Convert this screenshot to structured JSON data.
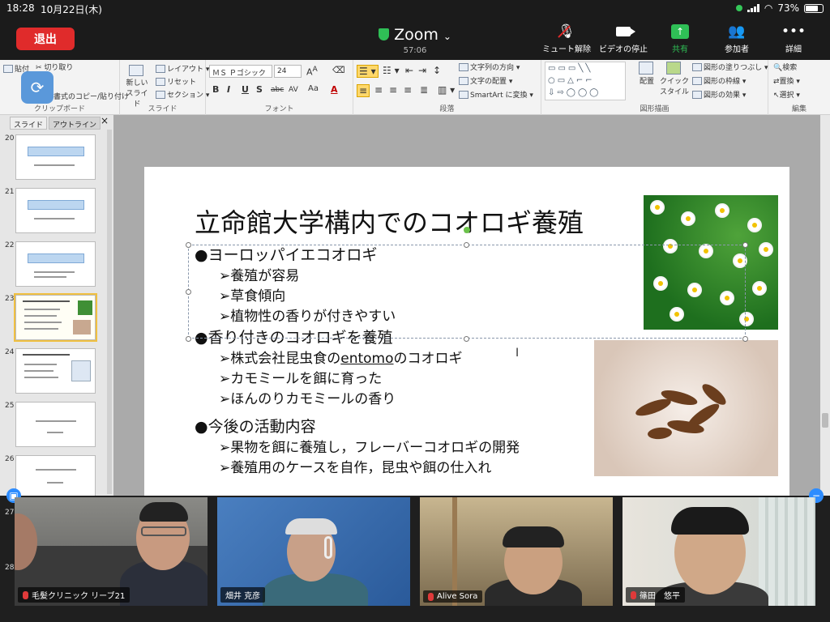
{
  "status_bar": {
    "time": "18:28",
    "date": "10月22日(木)",
    "battery": "73%",
    "battery_level": 0.73
  },
  "zoom": {
    "leave_label": "退出",
    "title": "Zoom",
    "elapsed": "57:06",
    "actions": [
      {
        "id": "mute",
        "label": "ミュート解除",
        "icon": "mic-off-icon"
      },
      {
        "id": "video",
        "label": "ビデオの停止",
        "icon": "video-camera-icon"
      },
      {
        "id": "share",
        "label": "共有",
        "icon": "share-arrow-icon"
      },
      {
        "id": "participants",
        "label": "参加者",
        "icon": "participants-icon"
      },
      {
        "id": "more",
        "label": "詳細",
        "icon": "more-dots-icon"
      }
    ]
  },
  "ribbon": {
    "clipboard": {
      "label": "クリップボード",
      "paste": "貼付",
      "cut": "切り取り",
      "copy_format": "書式のコピー/貼り付け"
    },
    "slides": {
      "label": "スライド",
      "new_slide": "新しい スライド",
      "layout": "レイアウト",
      "reset": "リセット",
      "section": "セクション"
    },
    "font": {
      "label": "フォント",
      "font_name": "ＭＳ Ｐゴシック",
      "font_size": "24",
      "bold": "B",
      "italic": "I",
      "underline": "U",
      "shadow": "S",
      "strike": "abc",
      "spacing": "AV",
      "case": "Aa",
      "color": "A"
    },
    "paragraph": {
      "label": "段落",
      "text_direction": "文字列の方向",
      "text_align": "文字の配置",
      "smartart": "SmartArt に変換"
    },
    "drawing": {
      "label": "図形描画",
      "arrange": "配置",
      "quick_styles": "クイック スタイル",
      "fill": "図形の塗りつぶし",
      "outline": "図形の枠線",
      "effects": "図形の効果"
    },
    "editing": {
      "label": "編集",
      "find": "検索",
      "replace": "置換",
      "select": "選択"
    }
  },
  "left_pane": {
    "tabs": [
      "スライド",
      "アウトライン"
    ],
    "close": "×",
    "thumbnails": [
      {
        "num": "20"
      },
      {
        "num": "21"
      },
      {
        "num": "22"
      },
      {
        "num": "23",
        "selected": true
      },
      {
        "num": "24"
      },
      {
        "num": "25"
      },
      {
        "num": "26"
      }
    ]
  },
  "slide": {
    "title": "立命館大学構内でのコオロギ養殖",
    "sections": [
      {
        "heading": "●ヨーロッパイエコオロギ",
        "items": [
          "➢養殖が容易",
          "➢草食傾向",
          "➢植物性の香りが付きやすい"
        ]
      },
      {
        "heading": "●香り付きのコオロギを養殖",
        "items": [
          "➢株式会社昆虫食のentomoのコオロギ",
          "➢カモミールを餌に育った",
          "➢ほんのりカモミールの香り"
        ]
      },
      {
        "heading": "●今後の活動内容",
        "items": [
          "➢果物を餌に養殖し，フレーバーコオロギの開発",
          "➢養殖用のケースを自作，昆虫や餌の仕入れ"
        ]
      }
    ]
  },
  "video_strip": {
    "row_numbers": [
      "27",
      "28"
    ],
    "participants": [
      {
        "name": "毛髪クリニック リーブ21",
        "muted": true
      },
      {
        "name": "畑井 克彦",
        "muted": false
      },
      {
        "name": "Alive Sora",
        "muted": true
      },
      {
        "name": "篠田　悠平",
        "muted": true
      }
    ]
  }
}
